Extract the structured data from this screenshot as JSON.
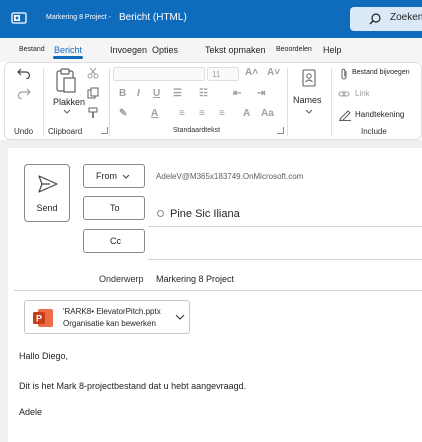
{
  "titlebar": {
    "doc_title": "Markering 8 Project -",
    "window_title": "Bericht (HTML)",
    "search_label": "Zoeken",
    "accent": "#0f6cbd"
  },
  "tabs": [
    {
      "label": "Bestand"
    },
    {
      "label": "Bericht"
    },
    {
      "label": "Invoegen"
    },
    {
      "label": "Opties"
    },
    {
      "label": "Tekst opmaken"
    },
    {
      "label": "Beoordelen"
    },
    {
      "label": "Help"
    }
  ],
  "ribbon": {
    "undo_group": "Undo",
    "clipboard_group": "Clipboard",
    "paste_label": "Plakken",
    "font_size": "11",
    "basic_text_group": "Standaardtekst",
    "names_label": "Names",
    "attach_file_label": "Bestand bijvoegen",
    "link_label": "Link",
    "signature_label": "Handtekening",
    "include_group": "Include"
  },
  "compose": {
    "send_label": "Send",
    "from_label": "From",
    "from_address": "AdeleV@M365x183749.OnMicrosoft.com",
    "to_label": "To",
    "to_value": "Pine Sic Iliana",
    "cc_label": "Cc",
    "subject_label": "Onderwerp",
    "subject_value": "Markering 8 Project"
  },
  "attachment": {
    "name": "'RARK8• ElevatorPitch.pptx",
    "permission": "Organisatie kan bewerken",
    "icon": "powerpoint-icon"
  },
  "body": {
    "greeting": "Hallo Diego,",
    "line1": "Dit is het Mark 8-projectbestand dat u hebt aangevraagd.",
    "signature": "Adele"
  }
}
